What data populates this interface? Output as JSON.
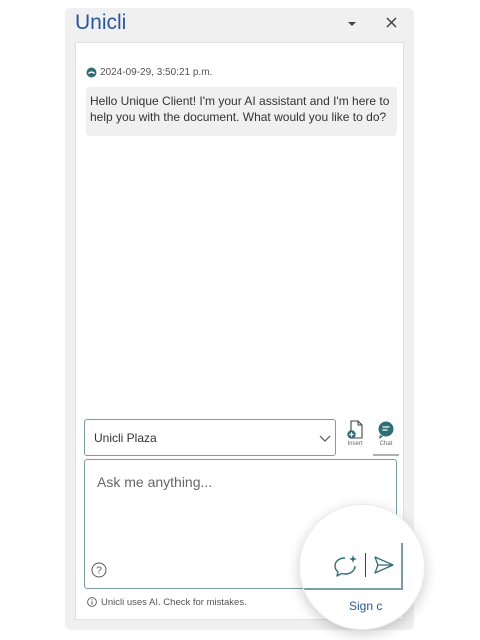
{
  "pane": {
    "title": "Unicli",
    "menu_icon": "caret-down-icon",
    "close_icon": "close-icon",
    "accent": "#2b579a"
  },
  "chat": {
    "timestamp": "2024-09-29, 3:50:21 p.m.",
    "message": "Hello Unique Client! I'm your AI assistant and I'm here to help you with the document. What would you like to do?"
  },
  "selector": {
    "value": "Unicli Plaza",
    "chevron_icon": "chevron-down-icon"
  },
  "modes": {
    "insert_label": "Insert",
    "chat_label": "Chat"
  },
  "input": {
    "placeholder": "Ask me anything...",
    "help_icon": "question-circle-icon",
    "sparkle_icon": "sparkle-chat-icon",
    "send_icon": "send-icon"
  },
  "footer": {
    "disclaimer": "Unicli uses AI. Check for mistakes.",
    "sign_in_partial": "Sign c"
  },
  "colors": {
    "border": "#7a9ea3",
    "chat_icon": "#2f6f73",
    "bubble_bg": "#f0f0f0"
  }
}
